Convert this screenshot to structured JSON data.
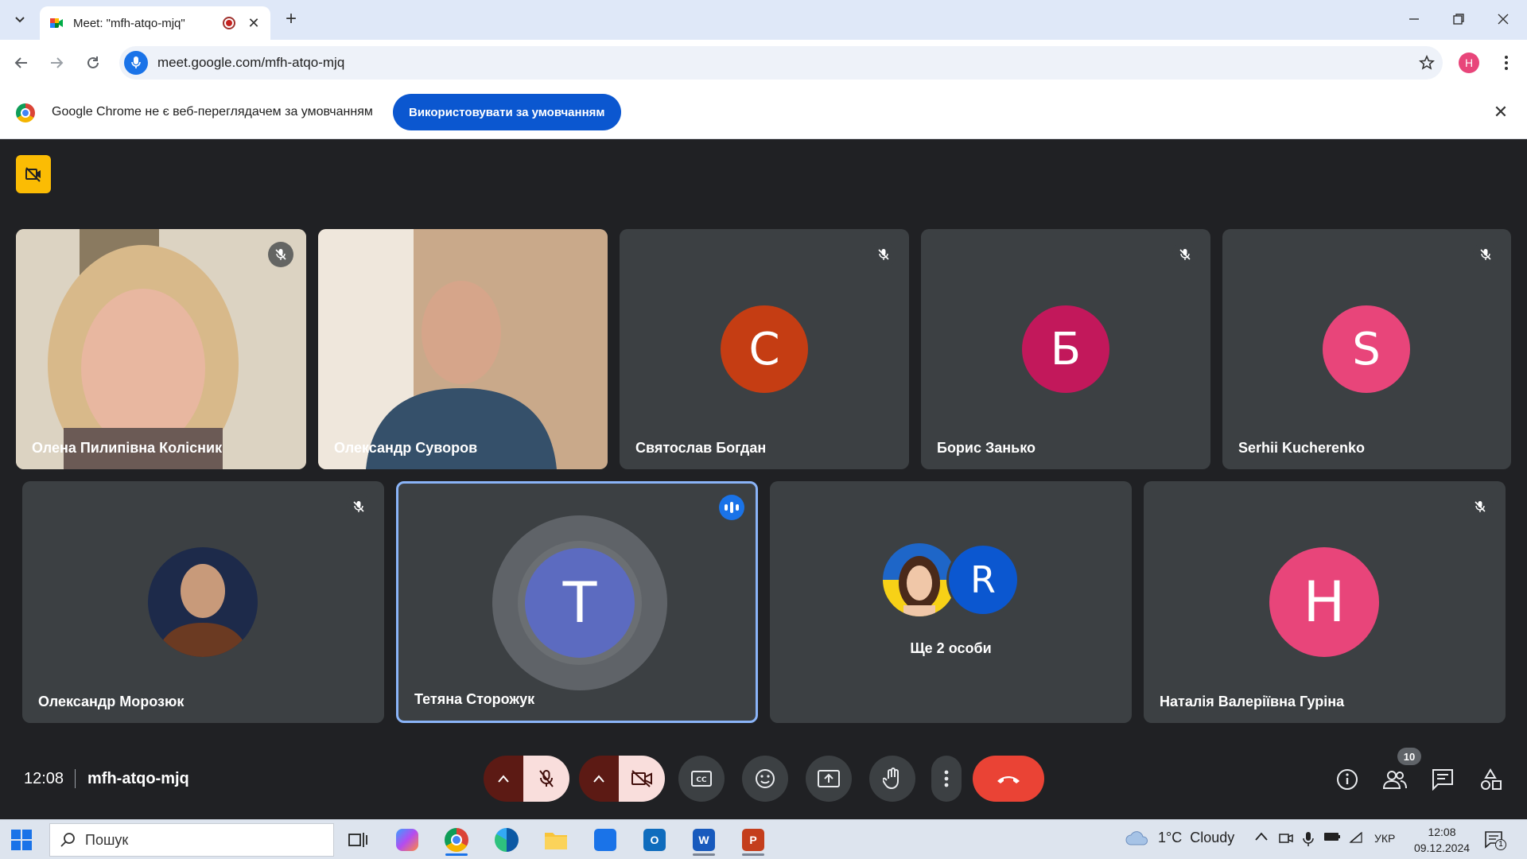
{
  "browser": {
    "tab_title": "Meet: \"mfh-atqo-mjq\"",
    "url": "meet.google.com/mfh-atqo-mjq",
    "profile_initial": "H"
  },
  "infobar": {
    "message": "Google Chrome не є веб-переглядачем за умовчанням",
    "button_label": "Використовувати за умовчанням"
  },
  "participants": {
    "row1": [
      {
        "name": "Олена Пилипівна Колісник",
        "type": "video",
        "muted": true
      },
      {
        "name": "Олександр Суворов",
        "type": "video",
        "muted": false
      },
      {
        "name": "Святослав Богдан",
        "initial": "С",
        "color": "#c53d13",
        "muted": true
      },
      {
        "name": "Борис Занько",
        "initial": "Б",
        "color": "#c2185b",
        "muted": true
      },
      {
        "name": "Serhii Kucherenko",
        "initial": "S",
        "color": "#e8457a",
        "muted": true
      }
    ],
    "row2": [
      {
        "name": "Олександр Морозюк",
        "type": "photo",
        "muted": true
      },
      {
        "name": "Тетяна Сторожук",
        "initial": "T",
        "color": "#5c6bc0",
        "speaking": true
      },
      {
        "name": "Ще 2 особи",
        "avatar2_initial": "R",
        "avatar2_color": "#0b57d0"
      },
      {
        "name": "Наталія Валеріївна Гуріна",
        "initial": "H",
        "color": "#e8457a",
        "muted": true
      }
    ]
  },
  "meeting": {
    "time": "12:08",
    "code": "mfh-atqo-mjq",
    "participant_count": "10"
  },
  "taskbar": {
    "search_placeholder": "Пошук",
    "weather": "1°C  Cloudy",
    "language": "УКР",
    "time": "12:08",
    "date": "09.12.2024",
    "notification_count": "1"
  }
}
